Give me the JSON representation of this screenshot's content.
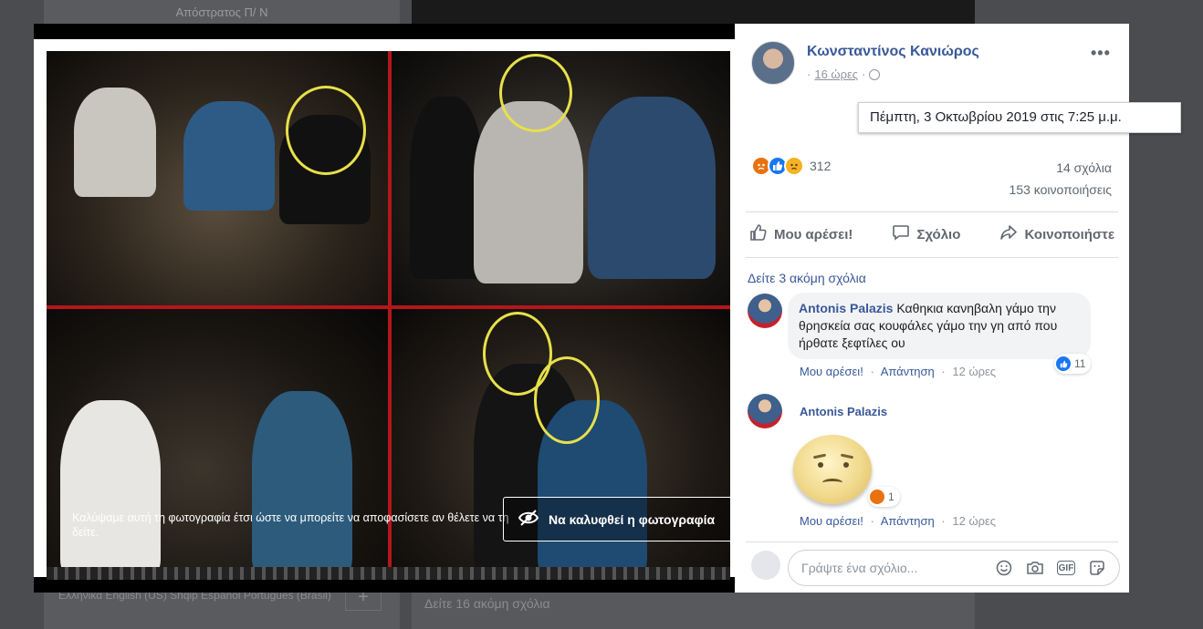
{
  "background": {
    "left_title": "Απόστρατος Π/ Ν",
    "languages": "Ελληνικά  English (US)  Shqip  Español  Português (Brasil)",
    "plus_label": "+",
    "more_comments": "Δείτε 16 ακόμη σχόλια"
  },
  "photo": {
    "cover_notice": "Καλύψαμε αυτή τη φωτογραφία έτσι ώστε να μπορείτε να αποφασίσετε αν θέλετε να τη δείτε.",
    "uncover_button": "Να καλυφθεί η φωτογραφία",
    "uncover_icon": "eye-slash-icon"
  },
  "post": {
    "author": "Κωνσταντίνος Κανιώρος",
    "time_prefix": "·",
    "time": "16 ώρες",
    "timestamp_tooltip": "Πέμπτη, 3 Οκτωβρίου 2019 στις 7:25 μ.μ.",
    "menu": "•••",
    "reaction_count": "312",
    "comments": "14 σχόλια",
    "shares": "153 κοινοποιήσεις",
    "actions": {
      "like": "Μου αρέσει!",
      "comment": "Σχόλιο",
      "share": "Κοινοποιήστε"
    }
  },
  "comments": {
    "more": "Δείτε 3 ακόμη σχόλια",
    "items": [
      {
        "author": "Antonis Palazis",
        "text": "Καθηκια κανηβαλη γάμο την θρησκεία σας κουφάλες γάμο την γη από που ήρθατε ξεφτίλες ου",
        "reaction_count": "11",
        "like": "Μου αρέσει!",
        "reply": "Απάντηση",
        "time": "12 ώρες"
      },
      {
        "author": "Antonis Palazis",
        "sticker": "sad-face-sticker",
        "reaction_count": "1",
        "like": "Μου αρέσει!",
        "reply": "Απάντηση",
        "time": "12 ώρες"
      }
    ]
  },
  "composer": {
    "placeholder": "Γράψτε ένα σχόλιο...",
    "gif_label": "GIF"
  },
  "colors": {
    "link": "#385898",
    "secondary": "#606770",
    "accent_red": "#b4161b",
    "circle_yellow": "#e8e04a"
  }
}
